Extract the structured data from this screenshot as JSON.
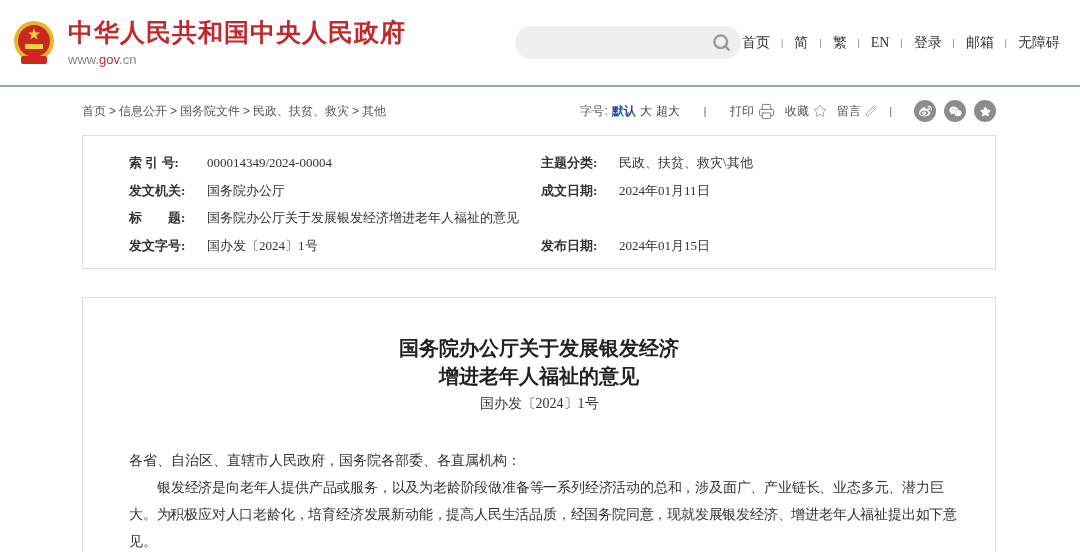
{
  "header": {
    "site_title": "中华人民共和国中央人民政府",
    "site_url_parts": [
      "www.",
      "gov",
      ".cn"
    ],
    "nav": {
      "separator": "|",
      "items": [
        "首页",
        "简",
        "繁",
        "EN",
        "登录",
        "邮箱",
        "无障碍"
      ]
    }
  },
  "breadcrumb": {
    "separator": ">",
    "items": [
      "首页",
      "信息公开",
      "国务院文件",
      "民政、扶贫、救灾",
      "其他"
    ]
  },
  "tools": {
    "font_size_label": "字号:",
    "font_sizes": [
      {
        "label": "默认",
        "selected": true
      },
      {
        "label": "大",
        "selected": false
      },
      {
        "label": "超大",
        "selected": false
      }
    ],
    "separator": "|",
    "print": "打印",
    "favorite": "收藏",
    "comment": "留言"
  },
  "meta": {
    "rows": [
      {
        "label": "索 引 号:",
        "value": "000014349/2024-00004",
        "label_2": "主题分类:",
        "value_2": "民政、扶贫、救灾\\其他"
      },
      {
        "label": "发文机关:",
        "value": "国务院办公厅",
        "label_2": "成文日期:",
        "value_2": "2024年01月11日"
      },
      {
        "label": "标　　题:",
        "value": "国务院办公厅关于发展银发经济增进老年人福祉的意见"
      },
      {
        "label": "发文字号:",
        "value": "国办发〔2024〕1号",
        "label_2": "发布日期:",
        "value_2": "2024年01月15日"
      }
    ]
  },
  "article": {
    "title_lines": [
      "国务院办公厅关于发展银发经济",
      "增进老年人福祉的意见"
    ],
    "doc_number": "国办发〔2024〕1号",
    "salutation": "各省、自治区、直辖市人民政府，国务院各部委、各直属机构：",
    "paragraphs": [
      "银发经济是向老年人提供产品或服务，以及为老龄阶段做准备等一系列经济活动的总和，涉及面广、产业链长、业态多元、潜力巨大。为积极应对人口老龄化，培育经济发展新动能，提高人民生活品质，经国务院同意，现就发展银发经济、增进老年人福祉提出如下意见。"
    ]
  }
}
